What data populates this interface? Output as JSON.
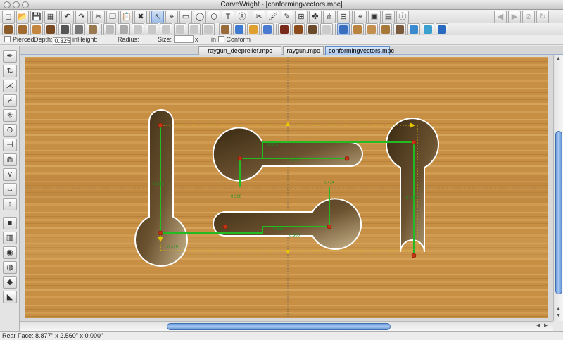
{
  "window": {
    "title": "CarveWright - [conformingvectors.mpc]"
  },
  "toolbar_top": {
    "buttons": [
      {
        "name": "new-file-button",
        "glyph": "◻"
      },
      {
        "name": "open-file-button",
        "glyph": "📂"
      },
      {
        "name": "save-button",
        "glyph": "💾"
      },
      {
        "name": "export-button",
        "glyph": "▦"
      },
      {
        "name": "undo-button",
        "glyph": "↶"
      },
      {
        "name": "redo-button",
        "glyph": "↷"
      },
      {
        "name": "cut-button",
        "glyph": "✂"
      },
      {
        "name": "copy-button",
        "glyph": "❐"
      },
      {
        "name": "paste-button",
        "glyph": "📋"
      },
      {
        "name": "delete-button",
        "glyph": "✖"
      },
      {
        "name": "select-tool-button",
        "glyph": "↖"
      },
      {
        "name": "node-edit-button",
        "glyph": "⌖"
      },
      {
        "name": "rectangle-tool-button",
        "glyph": "▭"
      },
      {
        "name": "circle-tool-button",
        "glyph": "◯"
      },
      {
        "name": "polygon-tool-button",
        "glyph": "⬡"
      },
      {
        "name": "text-tool-button",
        "glyph": "T"
      },
      {
        "name": "text-on-arc-button",
        "glyph": "Ⓐ"
      },
      {
        "name": "cutout-button",
        "glyph": "✂"
      },
      {
        "name": "paint-button",
        "glyph": "🖌"
      },
      {
        "name": "draw-line-button",
        "glyph": "✎"
      },
      {
        "name": "layers-button",
        "glyph": "⊞"
      },
      {
        "name": "puzzle-button",
        "glyph": "✤"
      },
      {
        "name": "hierarchy-button",
        "glyph": "⋔"
      },
      {
        "name": "templates-button",
        "glyph": "⊟"
      },
      {
        "name": "camera-button",
        "glyph": "⌖"
      },
      {
        "name": "view-layout-button",
        "glyph": "▣"
      },
      {
        "name": "view-3d-button",
        "glyph": "▤"
      },
      {
        "name": "info-button",
        "glyph": "ⓘ"
      },
      {
        "name": "back-button",
        "glyph": "◀"
      },
      {
        "name": "forward-button",
        "glyph": "▶"
      },
      {
        "name": "stop-button",
        "glyph": "⊘"
      },
      {
        "name": "refresh-button",
        "glyph": "↻"
      }
    ]
  },
  "toolbar_second": {
    "buttons": [
      {
        "name": "board-setup-button",
        "color": "#8a5a2b"
      },
      {
        "name": "board-wood-button",
        "color": "#a06a30"
      },
      {
        "name": "board-size-button",
        "color": "#c4863e"
      },
      {
        "name": "carve-preview-button",
        "color": "#7a4a22"
      },
      {
        "name": "bit-select-button",
        "color": "#555555"
      },
      {
        "name": "bit-settings-button",
        "color": "#777777"
      },
      {
        "name": "material-button",
        "color": "#9a7a50"
      },
      {
        "name": "mirror-button",
        "color": "#bbbbbb"
      },
      {
        "name": "rotate-button",
        "color": "#aaaaaa"
      },
      {
        "name": "align-left-button",
        "color": "#c8c8c8"
      },
      {
        "name": "align-center-button",
        "color": "#c8c8c8"
      },
      {
        "name": "align-right-button",
        "color": "#c8c8c8"
      },
      {
        "name": "scale-button",
        "color": "#c8c8c8"
      },
      {
        "name": "measure-button",
        "color": "#c8c8c8"
      },
      {
        "name": "group-button",
        "color": "#c8c8c8"
      },
      {
        "name": "bit-depth-button",
        "color": "#9a6a3a"
      },
      {
        "name": "paint-bucket-button",
        "color": "#3d7ad0"
      },
      {
        "name": "fill-button",
        "color": "#e0a030"
      },
      {
        "name": "zoom-tool-button",
        "color": "#4a7bd0"
      },
      {
        "name": "relief-r-button",
        "color": "#7a2a1a"
      },
      {
        "name": "relief-f-button",
        "color": "#8a4a1a"
      },
      {
        "name": "relief-g-button",
        "color": "#6a4a2a"
      },
      {
        "name": "pattern-button",
        "color": "#cccccc"
      },
      {
        "name": "view-top-button",
        "color": "#3a6fc0"
      },
      {
        "name": "view-wood-button",
        "color": "#b88440"
      },
      {
        "name": "view-grain-button",
        "color": "#c49050"
      },
      {
        "name": "view-texture-button",
        "color": "#a87838"
      },
      {
        "name": "view-dark-button",
        "color": "#7a5a3a"
      },
      {
        "name": "vector-path-button",
        "color": "#3a8ad0"
      },
      {
        "name": "node-circle-button",
        "color": "#3aa0d0"
      },
      {
        "name": "fit-board-button",
        "color": "#2a6ac0"
      }
    ]
  },
  "options": {
    "pierced_label": "Pierced",
    "depth_label": "Depth:",
    "depth_value": "0.325",
    "depth_unit": "in",
    "height_label": "Height:",
    "radius_label": "Radius:",
    "size_label": "Size:",
    "size_value": "",
    "size_x": "x",
    "size_unit": "in",
    "conform_label": "Conform"
  },
  "tabs": [
    {
      "label": "raygun_deeprelief.mpc",
      "active": false
    },
    {
      "label": "raygun.mpc",
      "active": false
    },
    {
      "label": "conformingvectors.mpc",
      "active": true
    }
  ],
  "left_tools": [
    {
      "name": "pen-tool-icon",
      "glyph": "✒"
    },
    {
      "name": "align-vertical-icon",
      "glyph": "⇅"
    },
    {
      "name": "node-split-icon",
      "glyph": "⋌"
    },
    {
      "name": "knife-tool-icon",
      "glyph": "⌿"
    },
    {
      "name": "star-node-icon",
      "glyph": "✳"
    },
    {
      "name": "center-tool-icon",
      "glyph": "⊙"
    },
    {
      "name": "path-end-icon",
      "glyph": "⊣"
    },
    {
      "name": "magnet-tool-icon",
      "glyph": "⋒"
    },
    {
      "name": "branch-tool-icon",
      "glyph": "⋎"
    },
    {
      "name": "horizontal-line-icon",
      "glyph": "↔"
    },
    {
      "name": "vertical-line-icon",
      "glyph": "↕"
    },
    {
      "name": "stop-cut-icon",
      "glyph": "■"
    },
    {
      "name": "wood-board-icon",
      "glyph": "▥"
    },
    {
      "name": "camera-view-icon",
      "glyph": "◉"
    },
    {
      "name": "wood-knot-icon",
      "glyph": "◍"
    },
    {
      "name": "cube-icon",
      "glyph": "◆"
    },
    {
      "name": "corner-tool-icon",
      "glyph": "◣"
    }
  ],
  "canvas": {
    "wood_color": "#c68f44",
    "wood_light": "#dcab66",
    "wood_dark": "#a9722f",
    "vector_color": "#22bb22",
    "guide_color": "#e8c800",
    "node_color": "#c83214",
    "labels": [
      "0.325",
      "0.325",
      "0.300",
      "0.300",
      "0.325",
      "0.325",
      "0.300",
      "0.300",
      "0.325"
    ]
  },
  "status": {
    "text": "Rear Face: 8.877\" x 2.560\" x 0.000\""
  }
}
